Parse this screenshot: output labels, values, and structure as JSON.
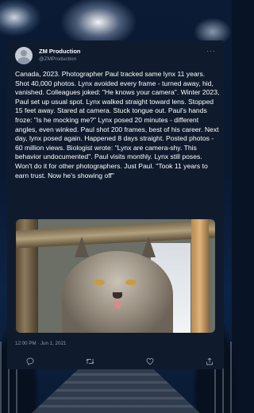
{
  "tweet": {
    "author": {
      "display_name": "ZM Production",
      "handle": "@ZMProduction"
    },
    "text": "Canada, 2023. Photographer Paul tracked same lynx 11 years. Shot 40,000 photos. Lynx avoided every frame - turned away, hid, vanished. Colleagues joked: \"He knows your camera\". Winter 2023, Paul set up usual spot. Lynx walked straight toward lens. Stopped 15 feet away. Stared at camera. Stuck tongue out. Paul's hands froze: \"Is he mocking me?\" Lynx posed 20 minutes - different angles, even winked. Paul shot 200 frames, best of his career. Next day, lynx posed again. Happened 8 days straight. Posted photos - 60 million views. Biologist wrote: \"Lynx are camera-shy. This behavior undocumented\". Paul visits monthly. Lynx still poses. Won't do it for other photographers. Just Paul. \"Took 11 years to earn trust. Now he's showing off\"",
    "timestamp": "12:00 PM · Jun 1, 2021",
    "more_label": "···"
  },
  "icons": {
    "avatar": "default-avatar-icon",
    "more": "more-options-icon",
    "reply": "reply-icon",
    "retweet": "retweet-icon",
    "like": "heart-icon",
    "share": "share-icon"
  },
  "colors": {
    "card_background": "#0f1b2d",
    "text": "#ffffff",
    "secondary_text": "#8b98a5",
    "page_background": "#081326"
  }
}
